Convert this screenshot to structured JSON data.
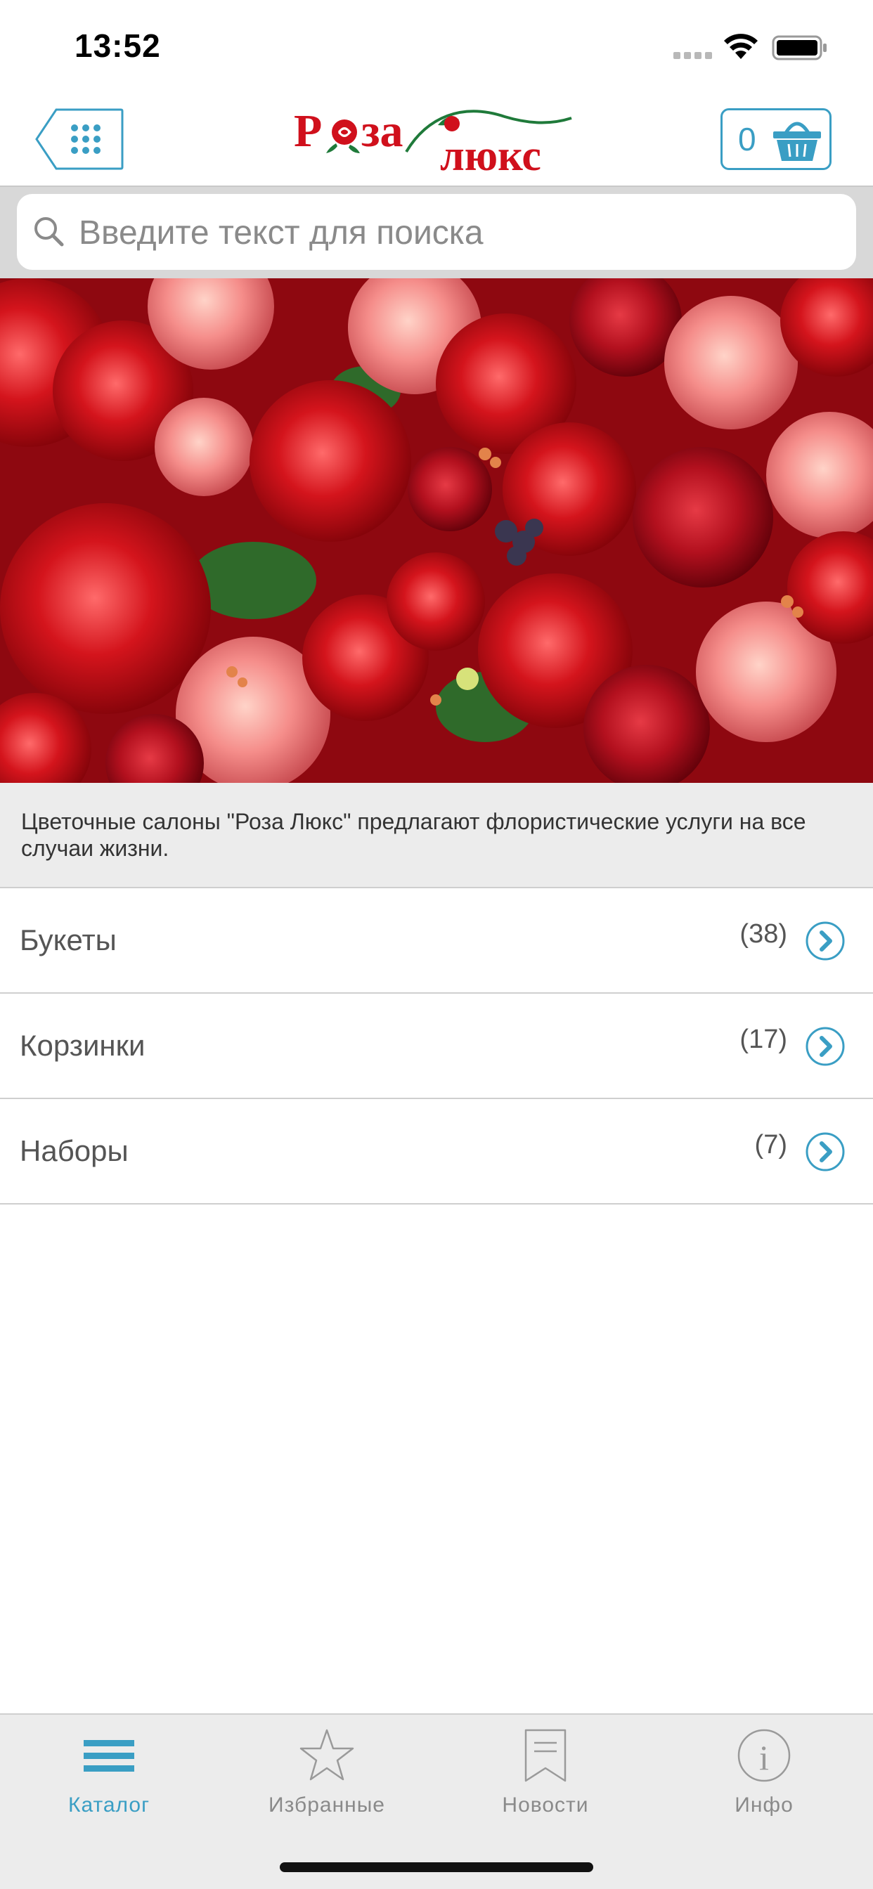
{
  "status_bar": {
    "time": "13:52"
  },
  "header": {
    "logo_text": "Роза Люкс",
    "cart_count": "0"
  },
  "search": {
    "placeholder": "Введите текст для поиска"
  },
  "banner": {
    "alt": "roses-banner"
  },
  "description": "Цветочные салоны \"Роза Люкс\" предлагают флористические услуги на все случаи жизни.",
  "categories": [
    {
      "label": "Букеты",
      "count": "(38)"
    },
    {
      "label": "Корзинки",
      "count": "(17)"
    },
    {
      "label": "Наборы",
      "count": "(7)"
    }
  ],
  "tabs": [
    {
      "label": "Каталог",
      "icon": "list-icon",
      "active": true
    },
    {
      "label": "Избранные",
      "icon": "star-icon",
      "active": false
    },
    {
      "label": "Новости",
      "icon": "bookmark-icon",
      "active": false
    },
    {
      "label": "Инфо",
      "icon": "info-icon",
      "active": false
    }
  ],
  "colors": {
    "accent": "#3a9ec4",
    "logo_red": "#d0101c",
    "logo_green": "#1f7a3a"
  }
}
